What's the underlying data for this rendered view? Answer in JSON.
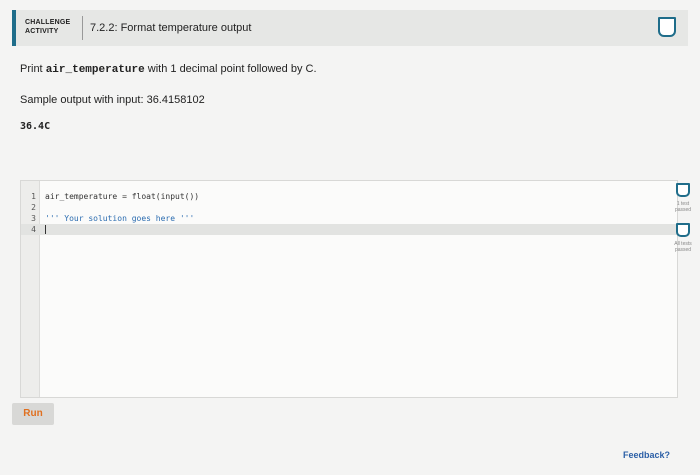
{
  "header": {
    "badge_line1": "CHALLENGE",
    "badge_line2": "ACTIVITY",
    "title": "7.2.2: Format temperature output"
  },
  "prompt": {
    "prefix": "Print ",
    "code": "air_temperature",
    "suffix": " with 1 decimal point followed by C."
  },
  "sample_text": "Sample output with input: 36.4158102",
  "sample_output": "36.4C",
  "editor": {
    "lines": [
      {
        "num": "1",
        "code": "air_temperature = float(input())"
      },
      {
        "num": "2",
        "code": ""
      },
      {
        "num": "3",
        "code": "''' Your solution goes here '''"
      },
      {
        "num": "4",
        "code": ""
      }
    ]
  },
  "tests": [
    {
      "label": "1 test passed"
    },
    {
      "label": "All tests passed"
    }
  ],
  "run_label": "Run",
  "feedback_label": "Feedback?",
  "colors": {
    "accent": "#1f6d8a",
    "run_text": "#e07020",
    "link": "#2b5fa6"
  }
}
